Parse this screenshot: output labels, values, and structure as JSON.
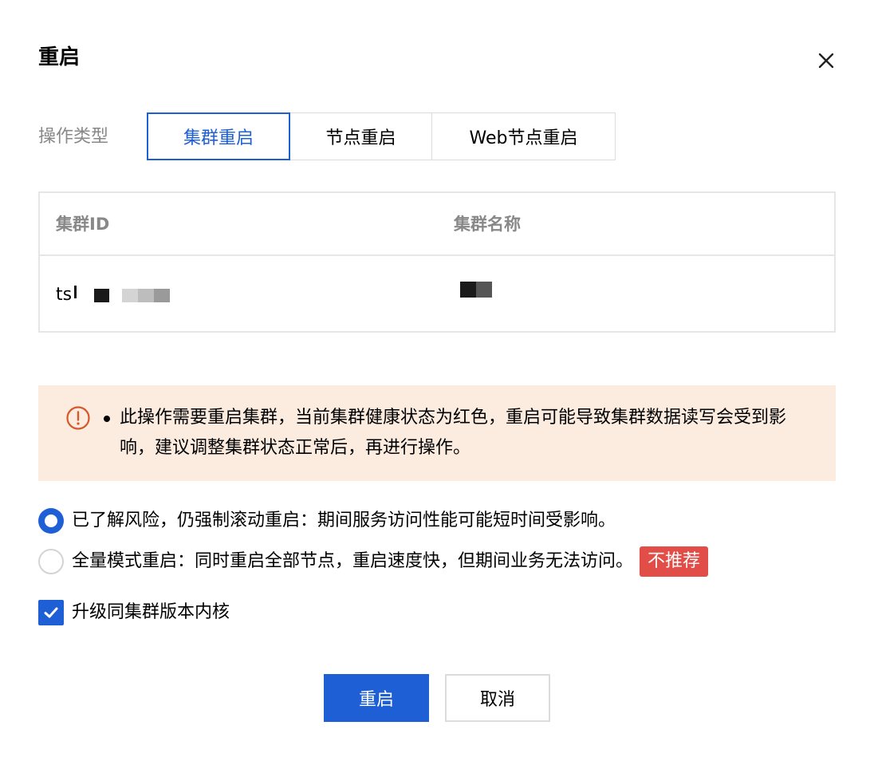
{
  "dialog": {
    "title": "重启",
    "close_icon": "close-icon"
  },
  "operation": {
    "label": "操作类型",
    "options": [
      "集群重启",
      "节点重启",
      "Web节点重启"
    ],
    "selected": "集群重启"
  },
  "table": {
    "columns": [
      "集群ID",
      "集群名称"
    ],
    "rows": [
      {
        "id_visible": "ts",
        "name_visible": ""
      }
    ]
  },
  "alert": {
    "icon": "warning-circle-icon",
    "text": "此操作需要重启集群，当前集群健康状态为红色，重启可能导致集群数据读写会受到影响，建议调整集群状态正常后，再进行操作。"
  },
  "restart_mode": {
    "options": [
      {
        "label": "已了解风险，仍强制滚动重启：期间服务访问性能可能短时间受影响。",
        "checked": true
      },
      {
        "label": "全量模式重启：同时重启全部节点，重启速度快，但期间业务无法访问。",
        "checked": false,
        "badge": "不推荐"
      }
    ]
  },
  "upgrade_kernel": {
    "label": "升级同集群版本内核",
    "checked": true
  },
  "buttons": {
    "confirm": "重启",
    "cancel": "取消"
  },
  "colors": {
    "primary": "#1f5fd6",
    "alert_bg": "#fcecdf",
    "alert_icon": "#d4582a",
    "badge_bg": "#e34d48",
    "muted_text": "#888888"
  }
}
